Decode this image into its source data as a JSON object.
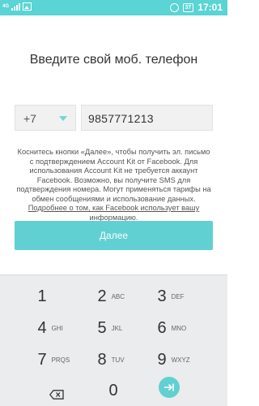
{
  "status_bar": {
    "network_label": "4G",
    "battery_level": "37",
    "time": "17:01"
  },
  "heading": "Введите свой моб. телефон",
  "country": {
    "code": "+7"
  },
  "phone": {
    "value": "9857771213"
  },
  "notice": {
    "text": "Коснитесь кнопки «Далее», чтобы получить эл. письмо с подтверждением Account Kit от Facebook. Для использования Account Kit не требуется аккаунт Facebook. Возможно, вы получите SMS для подтверждения номера. Могут применяться тарифы на обмен сообщениями и использование данных. ",
    "link": "Подробнее о том, как Facebook использует вашу информацию",
    "end": "."
  },
  "next_button": "Далее",
  "keypad": [
    {
      "num": "1",
      "letters": ""
    },
    {
      "num": "2",
      "letters": "ABC"
    },
    {
      "num": "3",
      "letters": "DEF"
    },
    {
      "num": "4",
      "letters": "GHI"
    },
    {
      "num": "5",
      "letters": "JKL"
    },
    {
      "num": "6",
      "letters": "MNO"
    },
    {
      "num": "7",
      "letters": "PRQS"
    },
    {
      "num": "8",
      "letters": "TUV"
    },
    {
      "num": "9",
      "letters": "WXYZ"
    },
    {
      "num": "0",
      "letters": ""
    }
  ],
  "icons": {
    "backspace": "backspace-icon",
    "enter": "enter-icon",
    "dropdown": "chevron-down-icon"
  },
  "colors": {
    "accent": "#5ad4d4",
    "button": "#61d0d2"
  }
}
